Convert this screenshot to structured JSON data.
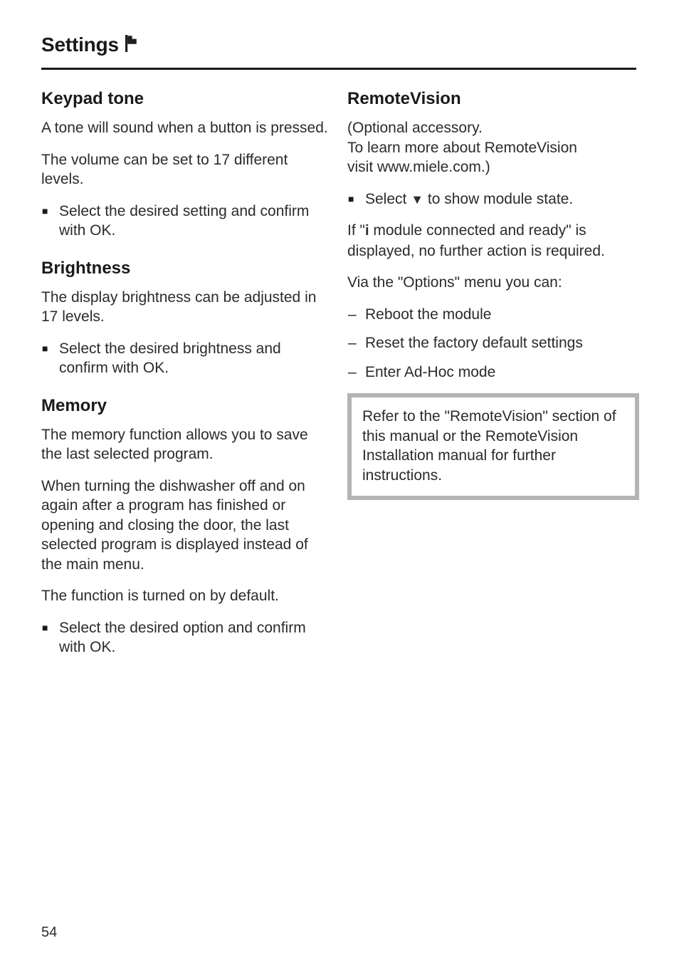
{
  "header": {
    "title": "Settings",
    "icon": "flag-icon"
  },
  "left_column": {
    "sections": [
      {
        "heading": "Keypad tone",
        "paragraphs": [
          "A tone will sound when a button is pressed.",
          "The volume can be set to 17 different levels."
        ],
        "bullets": [
          "Select the desired setting and confirm with OK."
        ]
      },
      {
        "heading": "Brightness",
        "paragraphs": [
          "The display brightness can be adjusted in 17 levels."
        ],
        "bullets": [
          "Select the desired brightness and confirm with OK."
        ]
      },
      {
        "heading": "Memory",
        "paragraphs": [
          "The memory function allows you to save the last selected program.",
          "When turning the dishwasher off and on again after a program has finished or opening and closing the door, the last selected program is displayed instead of the main menu.",
          "The function is turned on by default."
        ],
        "bullets": [
          "Select the desired option and confirm with OK."
        ]
      }
    ]
  },
  "right_column": {
    "heading": "RemoteVision",
    "intro_line_1": "(Optional accessory.",
    "intro_line_2": "To learn more about RemoteVision",
    "intro_line_3": "visit www.miele.com.)",
    "bullet_select_prefix": "Select",
    "bullet_select_arrow": "▼",
    "bullet_select_suffix": "to show module state.",
    "module_ready_prefix": "If \"",
    "module_ready_symbol": "i",
    "module_ready_suffix": " module connected and ready\" is displayed, no further action is required.",
    "options_intro": "Via the \"Options\" menu you can:",
    "dash_items": [
      "Reboot the module",
      "Reset the factory default settings",
      "Enter Ad-Hoc mode"
    ],
    "note": "Refer to the \"RemoteVision\" section of this manual or the RemoteVision Installation manual for further instructions."
  },
  "footer": {
    "page_number": "54"
  },
  "markers": {
    "bullet_square": "■",
    "dash": "–"
  },
  "colors": {
    "text": "#2b2b2b",
    "heading": "#1a1a1a",
    "rule": "#1a1a1a",
    "note_border": "#b4b4b4",
    "background": "#ffffff"
  }
}
